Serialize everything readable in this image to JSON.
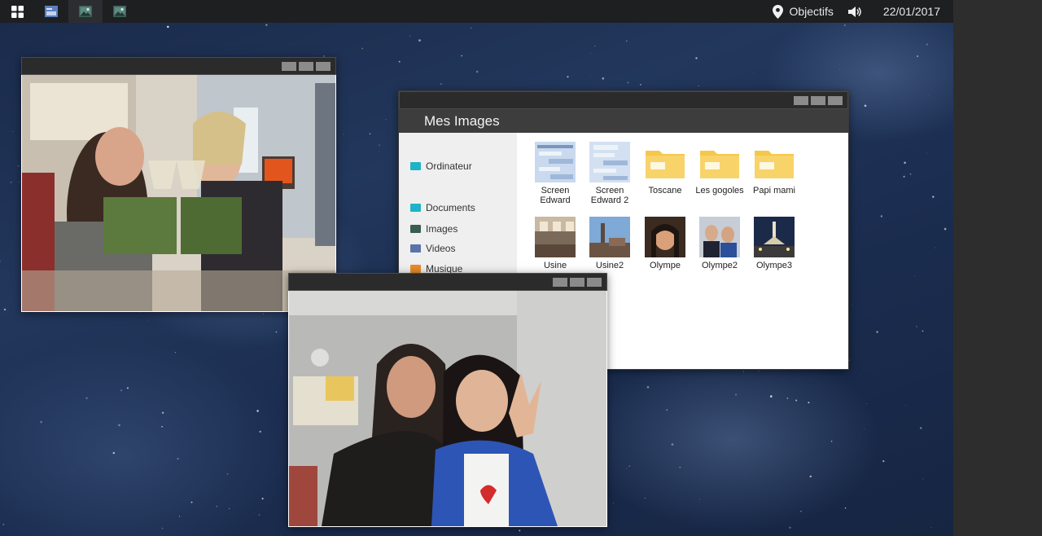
{
  "taskbar": {
    "icons": [
      "grid-icon",
      "folder-window-icon",
      "image-window-icon",
      "image-window-icon"
    ],
    "objectives_label": "Objectifs",
    "date": "22/01/2017"
  },
  "explorer": {
    "title": "Mes Images",
    "sidebar": [
      {
        "label": "Ordinateur",
        "icon": "computer-icon",
        "color": "#1fb3c7"
      },
      {
        "label": "Documents",
        "icon": "documents-icon",
        "color": "#1fb3c7"
      },
      {
        "label": "Images",
        "icon": "images-icon",
        "color": "#3a5c52"
      },
      {
        "label": "Videos",
        "icon": "videos-icon",
        "color": "#5a73a8"
      },
      {
        "label": "Musique",
        "icon": "music-icon",
        "color": "#e88b2a"
      }
    ],
    "files": [
      {
        "label": "Screen Edward",
        "type": "screenshot"
      },
      {
        "label": "Screen Edward 2",
        "type": "screenshot"
      },
      {
        "label": "Toscane",
        "type": "folder"
      },
      {
        "label": "Les gogoles",
        "type": "folder"
      },
      {
        "label": "Papi mami",
        "type": "folder"
      },
      {
        "label": "Usine",
        "type": "image"
      },
      {
        "label": "Usine2",
        "type": "image"
      },
      {
        "label": "Olympe",
        "type": "image"
      },
      {
        "label": "Olympe2",
        "type": "image"
      },
      {
        "label": "Olympe3",
        "type": "image"
      }
    ]
  },
  "colors": {
    "taskbar": "#1e1f21",
    "titlebar": "#2b2b2b",
    "explorer_header": "#3d3d3d",
    "folder": "#f5c84a"
  }
}
